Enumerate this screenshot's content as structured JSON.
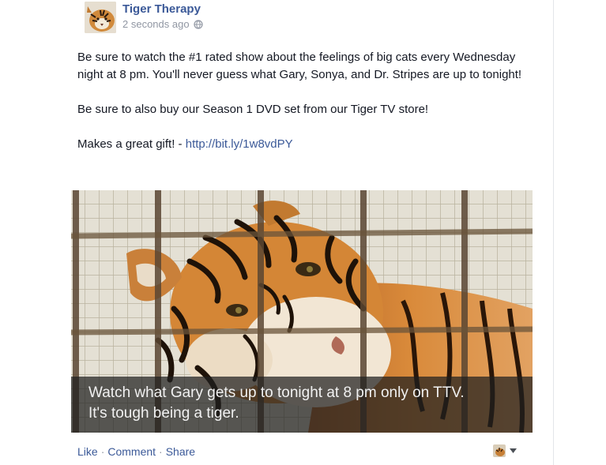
{
  "post": {
    "page_name": "Tiger Therapy",
    "timestamp": "2 seconds ago",
    "privacy_icon": "globe-icon",
    "text": {
      "paragraph_1": "Be sure to watch the #1 rated show about the feelings of big cats every Wednesday night at 8 pm. You'll never guess what Gary, Sonya, and Dr. Stripes are up to tonight!",
      "paragraph_2": "Be sure to also buy our Season 1 DVD set from our Tiger TV store!",
      "paragraph_3_prefix": "Makes a great gift! - ",
      "link": "http://bit.ly/1w8vdPY"
    },
    "photo": {
      "caption_line_1": "Watch what Gary gets up to tonight at 8 pm only on TTV.",
      "caption_line_2": "It's tough being a tiger."
    },
    "actions": {
      "like": "Like",
      "comment": "Comment",
      "share": "Share",
      "separator": "·"
    }
  },
  "colors": {
    "link_blue": "#3b5998",
    "meta_gray": "#9197a3",
    "tiger_orange": "#d98a3a"
  }
}
